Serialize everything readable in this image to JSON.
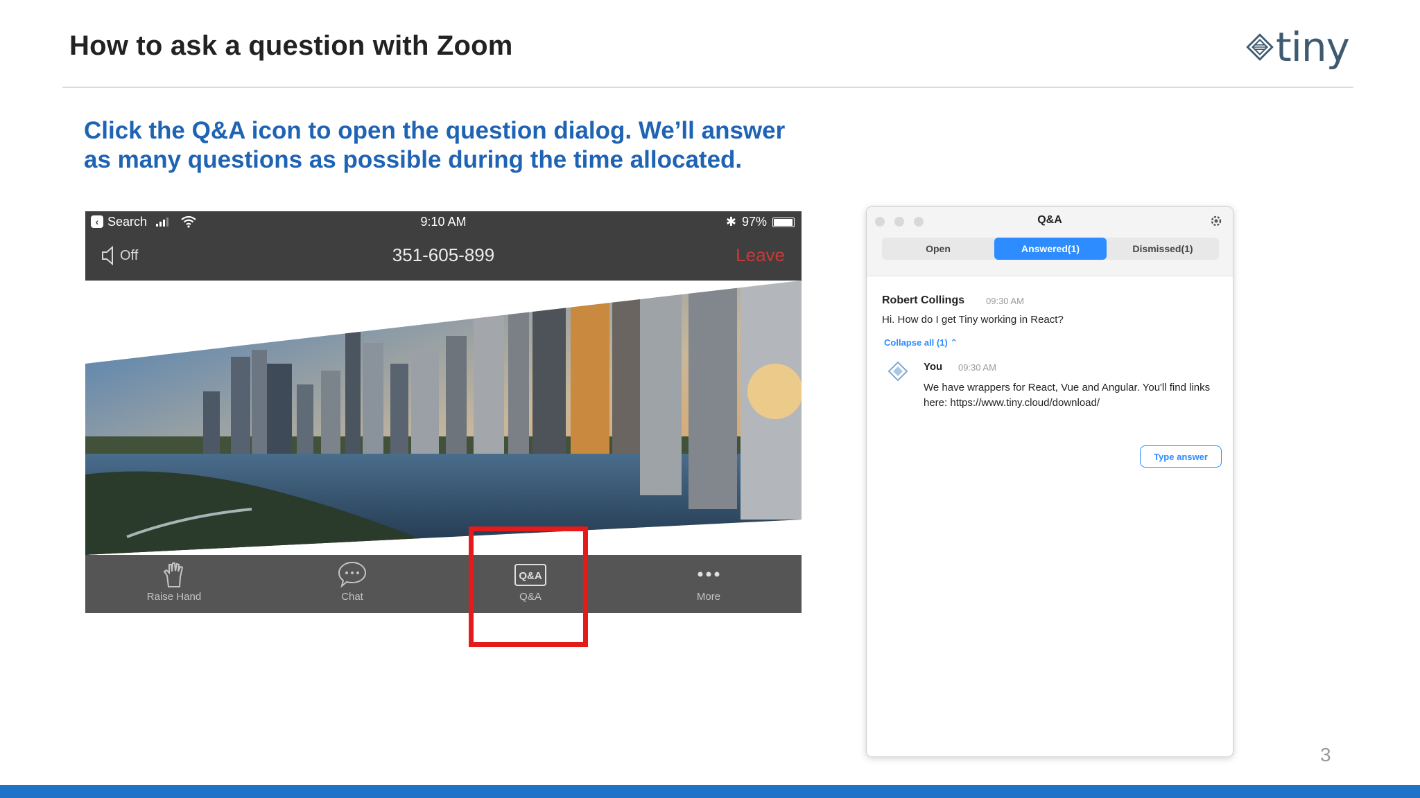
{
  "slide": {
    "title": "How to ask a question with Zoom",
    "logo_text": "tiny",
    "instruction": "Click the Q&A icon to open the question dialog. We’ll answer as many questions as possible during the time allocated.",
    "page_number": "3"
  },
  "phone": {
    "status": {
      "back_label": "Search",
      "time": "9:10 AM",
      "bluetooth": "✱",
      "battery": "97%",
      "battery_level": 0.97
    },
    "header": {
      "speaker_label": "Off",
      "meeting_id": "351-605-899",
      "leave_label": "Leave"
    },
    "toolbar": [
      {
        "label": "Raise Hand",
        "icon": "raise-hand-icon"
      },
      {
        "label": "Chat",
        "icon": "chat-icon"
      },
      {
        "label": "Q&A",
        "icon": "qa-icon"
      },
      {
        "label": "More",
        "icon": "more-icon"
      }
    ]
  },
  "qa_panel": {
    "title": "Q&A",
    "tabs": [
      {
        "label": "Open",
        "active": false
      },
      {
        "label": "Answered(1)",
        "active": true
      },
      {
        "label": "Dismissed(1)",
        "active": false
      }
    ],
    "question": {
      "author": "Robert Collings",
      "time": "09:30 AM",
      "text": "Hi. How do I get Tiny working in React?"
    },
    "collapse_label": "Collapse all (1) ⌃",
    "answer": {
      "author": "You",
      "time": "09:30 AM",
      "text": "We have wrappers for React, Vue and Angular. You'll find links here: https://www.tiny.cloud/download/"
    },
    "type_answer_label": "Type answer"
  },
  "colors": {
    "accent_blue": "#1e63b4",
    "zoom_blue": "#2d8cff",
    "highlight_red": "#e51a1a",
    "leave_red": "#c83a3a",
    "bottom_bar": "#1e73c8"
  }
}
